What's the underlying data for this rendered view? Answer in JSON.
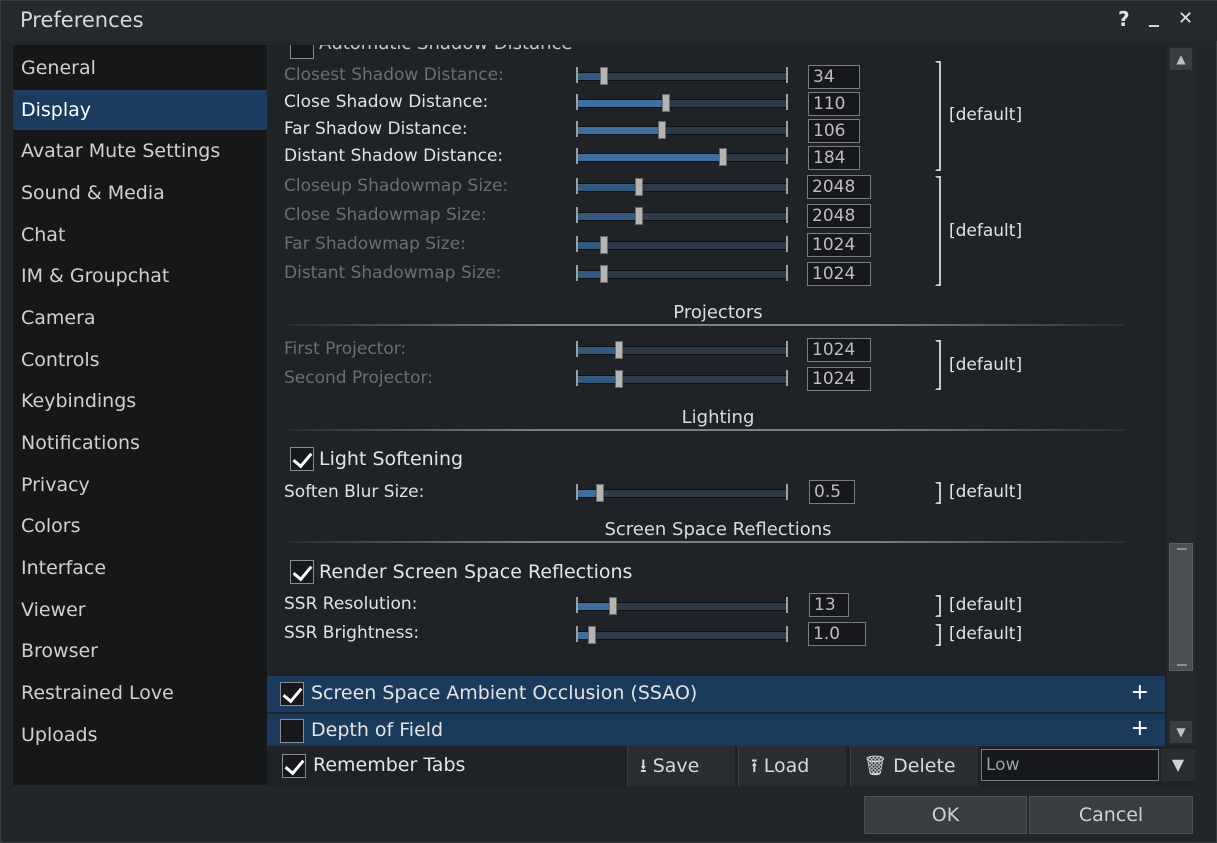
{
  "window": {
    "title": "Preferences",
    "help": "?",
    "minimize": "_",
    "close": "✕"
  },
  "sidebar": {
    "items": [
      {
        "label": "General"
      },
      {
        "label": "Display"
      },
      {
        "label": "Avatar Mute Settings"
      },
      {
        "label": "Sound & Media"
      },
      {
        "label": "Chat"
      },
      {
        "label": "IM & Groupchat"
      },
      {
        "label": "Camera"
      },
      {
        "label": "Controls"
      },
      {
        "label": "Keybindings"
      },
      {
        "label": "Notifications"
      },
      {
        "label": "Privacy"
      },
      {
        "label": "Colors"
      },
      {
        "label": "Interface"
      },
      {
        "label": "Viewer"
      },
      {
        "label": "Browser"
      },
      {
        "label": "Restrained Love"
      },
      {
        "label": "Uploads"
      }
    ],
    "active": "Display"
  },
  "shadows": {
    "auto_label": "Automatic Shadow Distance",
    "rows": [
      {
        "label": "Closest Shadow Distance:",
        "value": "34",
        "level": 0.12
      },
      {
        "label": "Close Shadow Distance:",
        "value": "110",
        "level": 0.42
      },
      {
        "label": "Far Shadow Distance:",
        "value": "106",
        "level": 0.4
      },
      {
        "label": "Distant Shadow Distance:",
        "value": "184",
        "level": 0.7
      },
      {
        "label": "Closeup Shadowmap Size:",
        "value": "2048",
        "level": 0.29
      },
      {
        "label": "Close Shadowmap Size:",
        "value": "2048",
        "level": 0.29
      },
      {
        "label": "Far Shadowmap Size:",
        "value": "1024",
        "level": 0.12
      },
      {
        "label": "Distant Shadowmap Size:",
        "value": "1024",
        "level": 0.12
      }
    ],
    "default_label": "[default]"
  },
  "projectors": {
    "title": "Projectors",
    "rows": [
      {
        "label": "First Projector:",
        "value": "1024",
        "level": 0.19
      },
      {
        "label": "Second Projector:",
        "value": "1024",
        "level": 0.19
      }
    ],
    "default_label": "[default]"
  },
  "lighting": {
    "title": "Lighting",
    "softening_label": "Light Softening",
    "blur_label": "Soften Blur Size:",
    "blur_value": "0.5",
    "blur_level": 0.1,
    "default_label": "[default]"
  },
  "ssr": {
    "title": "Screen Space Reflections",
    "render_label": "Render Screen Space Reflections",
    "resolution_label": "SSR Resolution:",
    "resolution_value": "13",
    "resolution_level": 0.16,
    "brightness_label": "SSR Brightness:",
    "brightness_value": "1.0",
    "brightness_level": 0.06,
    "default_label": "[default]"
  },
  "accordions": {
    "ssao_label": "Screen Space Ambient Occlusion (SSAO)",
    "dof_label": "Depth of Field",
    "plus": "+"
  },
  "bottombar": {
    "remember_label": "Remember Tabs",
    "save_label": "Save",
    "load_label": "Load",
    "delete_label": "Delete",
    "preset_value": "Low"
  },
  "dialog": {
    "ok_label": "OK",
    "cancel_label": "Cancel"
  }
}
